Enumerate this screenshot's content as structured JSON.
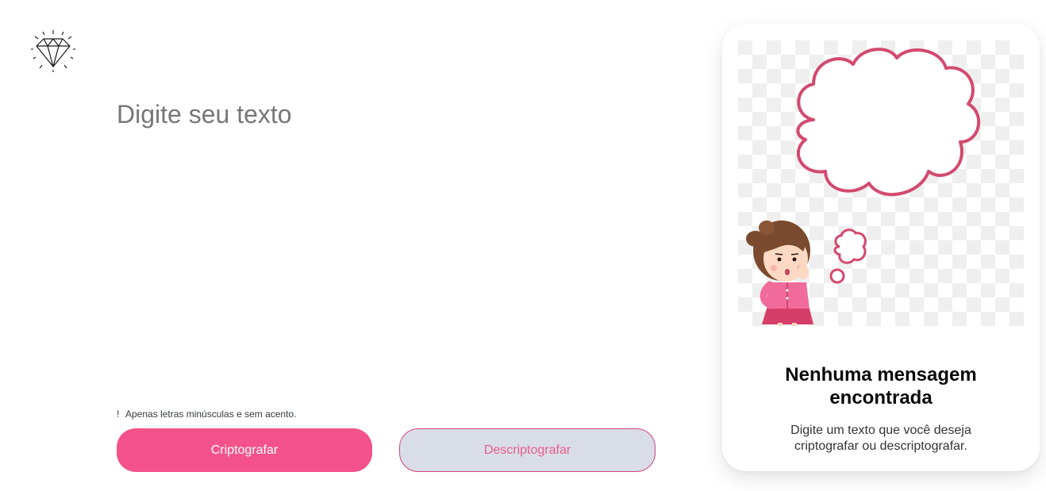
{
  "logo": {
    "icon": "diamond-icon"
  },
  "input": {
    "placeholder": "Digite seu texto"
  },
  "hint": {
    "icon_glyph": "!",
    "text": "Apenas letras minúsculas e sem acento."
  },
  "buttons": {
    "encrypt_label": "Criptografar",
    "decrypt_label": "Descriptografar"
  },
  "output_card": {
    "title_line1": "Nenhuma mensagem",
    "title_line2": "encontrada",
    "text_line1": "Digite um texto que você deseja",
    "text_line2": "criptografar ou descriptografar.",
    "illustration": "girl-thinking-illustration"
  },
  "colors": {
    "accent": "#f3538a",
    "secondary_button_bg": "#d8dde7",
    "secondary_button_border": "#d4467a",
    "thought_bubble_stroke": "#d34a6e"
  }
}
